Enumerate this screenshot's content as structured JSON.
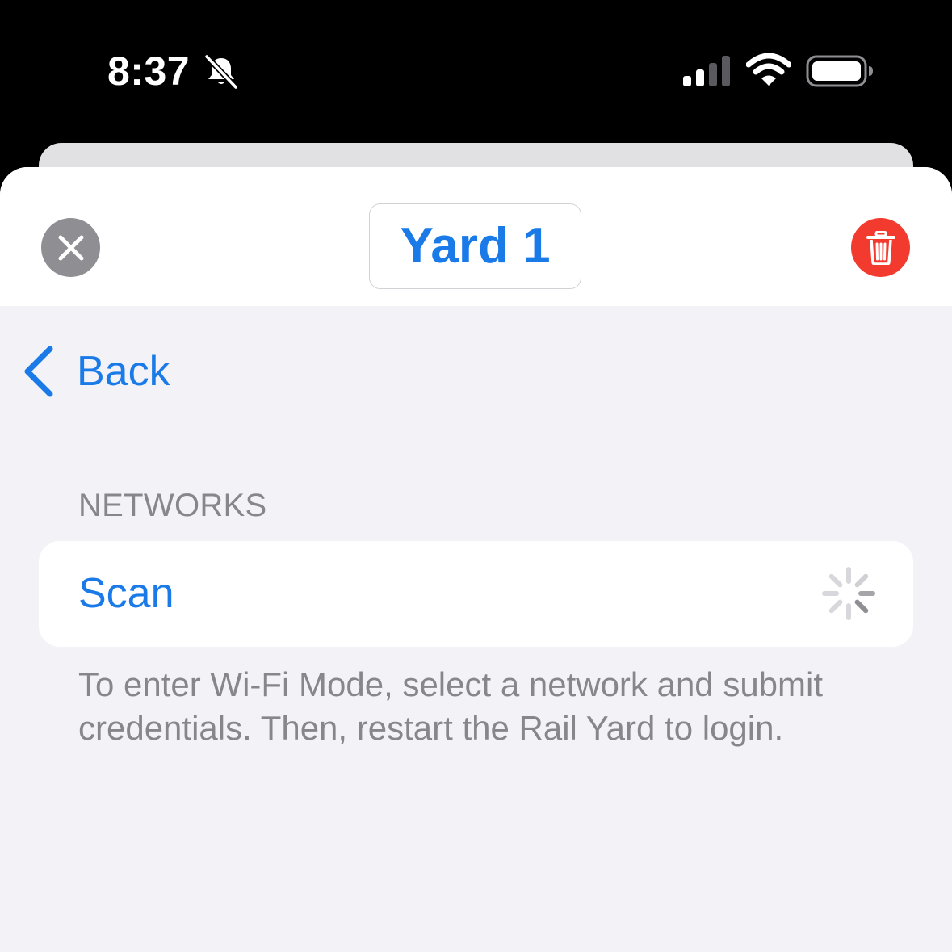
{
  "status_bar": {
    "time": "8:37",
    "mute_icon": "bell-slash-icon",
    "signal_icon": "cellular-signal-icon",
    "wifi_icon": "wifi-icon",
    "battery_icon": "battery-icon"
  },
  "header": {
    "close_icon": "close-icon",
    "title": "Yard 1",
    "delete_icon": "trash-icon"
  },
  "nav": {
    "back_label": "Back",
    "back_icon": "chevron-left-icon"
  },
  "networks": {
    "section_header": "NETWORKS",
    "scan_label": "Scan",
    "spinner_icon": "activity-spinner-icon",
    "footer": "To enter Wi-Fi Mode, select a network and submit credentials. Then, restart the Rail Yard to login."
  },
  "colors": {
    "accent": "#1a7be8",
    "destructive": "#f33a2e",
    "secondary_text": "#86868b",
    "grouped_background": "#f2f2f7"
  }
}
